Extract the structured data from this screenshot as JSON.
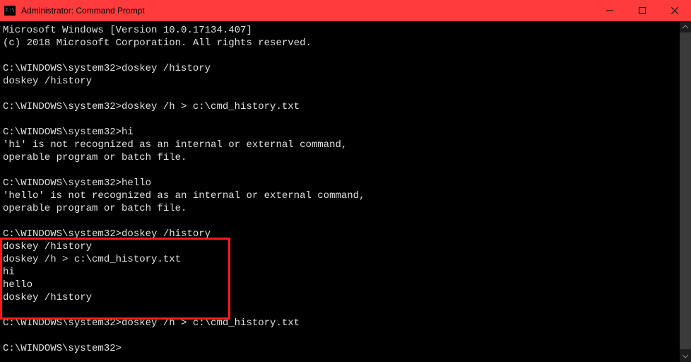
{
  "titlebar": {
    "title": "Administrator: Command Prompt"
  },
  "terminal": {
    "lines": [
      "Microsoft Windows [Version 10.0.17134.407]",
      "(c) 2018 Microsoft Corporation. All rights reserved.",
      "",
      "C:\\WINDOWS\\system32>doskey /history",
      "doskey /history",
      "",
      "C:\\WINDOWS\\system32>doskey /h > c:\\cmd_history.txt",
      "",
      "C:\\WINDOWS\\system32>hi",
      "'hi' is not recognized as an internal or external command,",
      "operable program or batch file.",
      "",
      "C:\\WINDOWS\\system32>hello",
      "'hello' is not recognized as an internal or external command,",
      "operable program or batch file.",
      "",
      "C:\\WINDOWS\\system32>doskey /history",
      "doskey /history",
      "doskey /h > c:\\cmd_history.txt",
      "hi",
      "hello",
      "doskey /history",
      "",
      "C:\\WINDOWS\\system32>doskey /h > c:\\cmd_history.txt",
      "",
      "C:\\WINDOWS\\system32>"
    ]
  }
}
